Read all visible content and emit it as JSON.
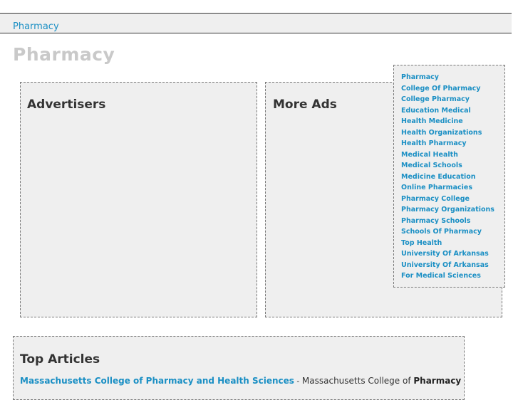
{
  "breadcrumb": {
    "label": "Pharmacy"
  },
  "page": {
    "title": "Pharmacy"
  },
  "advertisers": {
    "title": "Advertisers"
  },
  "more_ads": {
    "title": "More Ads"
  },
  "keywords": [
    "Pharmacy",
    "College Of Pharmacy",
    "College Pharmacy",
    "Education Medical",
    "Health Medicine",
    "Health Organizations",
    "Health Pharmacy",
    "Medical Health",
    "Medical Schools",
    "Medicine Education",
    "Online Pharmacies",
    "Pharmacy College",
    "Pharmacy Organizations",
    "Pharmacy Schools",
    "Schools Of Pharmacy",
    "Top Health",
    "University Of Arkansas",
    "University Of Arkansas",
    "For Medical Sciences"
  ],
  "top_articles": {
    "title": "Top Articles",
    "items": [
      {
        "link": "Massachusetts College of Pharmacy and Health Sciences",
        "separator": " - ",
        "snippet": "Massachusetts College of ",
        "highlight": "Pharmacy"
      }
    ]
  },
  "colors": {
    "link": "#1a8fc4",
    "panel_bg": "#efefef",
    "title_gray": "#c9c9c9"
  }
}
